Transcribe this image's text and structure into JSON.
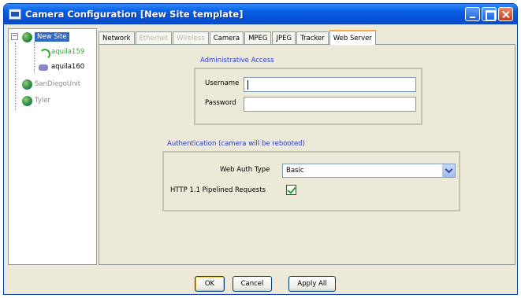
{
  "window": {
    "title": "Camera Configuration [New Site template]"
  },
  "tree": {
    "root": {
      "label": "New Site",
      "expander": "−"
    },
    "cameras": [
      {
        "label": "aquila159",
        "color": "#2fae2f",
        "icon": "camera-online-icon"
      },
      {
        "label": "aquila160",
        "color": "#000000",
        "icon": "camera-icon"
      }
    ],
    "sites": [
      {
        "label": "SanDiegoUnit"
      },
      {
        "label": "Tyler"
      }
    ],
    "site_expanders": [
      "+",
      "+"
    ]
  },
  "tabs": [
    {
      "label": "Network",
      "state": "enabled"
    },
    {
      "label": "Ethernet",
      "state": "disabled"
    },
    {
      "label": "Wireless",
      "state": "disabled"
    },
    {
      "label": "Camera",
      "state": "enabled"
    },
    {
      "label": "MPEG",
      "state": "enabled"
    },
    {
      "label": "JPEG",
      "state": "enabled"
    },
    {
      "label": "Tracker",
      "state": "enabled"
    },
    {
      "label": "Web Server",
      "state": "active"
    }
  ],
  "admin_access": {
    "title": "Administrative Access",
    "username_label": "Username",
    "username_value": "",
    "password_label": "Password",
    "password_value": ""
  },
  "authentication": {
    "title": "Authentication (camera will be rebooted)",
    "web_auth_label": "Web Auth Type",
    "web_auth_value": "Basic",
    "pipelined_label": "HTTP 1.1 Pipelined Requests",
    "pipelined_checked": true
  },
  "buttons": {
    "ok": "OK",
    "cancel": "Cancel",
    "apply_all": "Apply All"
  },
  "colors": {
    "section_title": "#2a3dbe",
    "selection": "#316ac5",
    "titlebar": "#0a5fe6"
  }
}
